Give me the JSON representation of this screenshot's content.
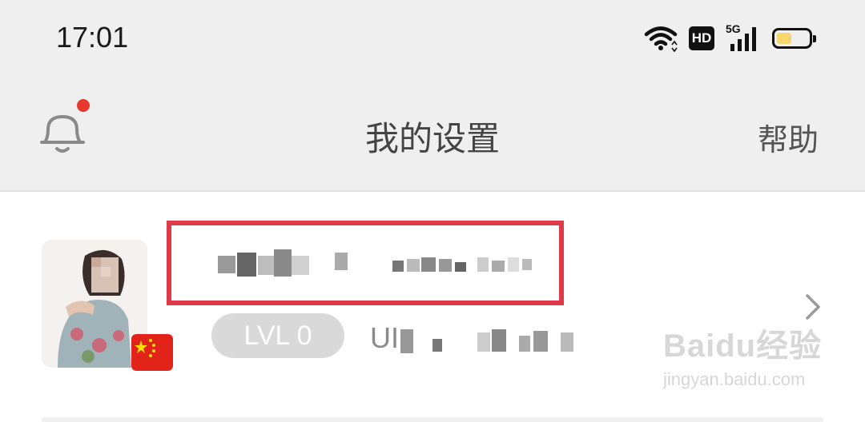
{
  "status_bar": {
    "time": "17:01",
    "hd_label": "HD",
    "network_label": "5G",
    "icons": [
      "wifi-icon",
      "hd-icon",
      "signal-5g-icon",
      "battery-icon"
    ],
    "battery_color": "#f5d76e"
  },
  "header": {
    "title": "我的设置",
    "help_label": "帮助",
    "notification_dot_color": "#e8372c",
    "left_icon": "bell-icon"
  },
  "profile": {
    "username": "",
    "level_label": "LVL 0",
    "uid_prefix": "UI",
    "avatar": "avatar-photo",
    "badge": "china-flag",
    "highlight_color": "#e03a4a"
  },
  "watermark": {
    "logo_text": "Baidu经验",
    "url": "jingyan.baidu.com"
  }
}
